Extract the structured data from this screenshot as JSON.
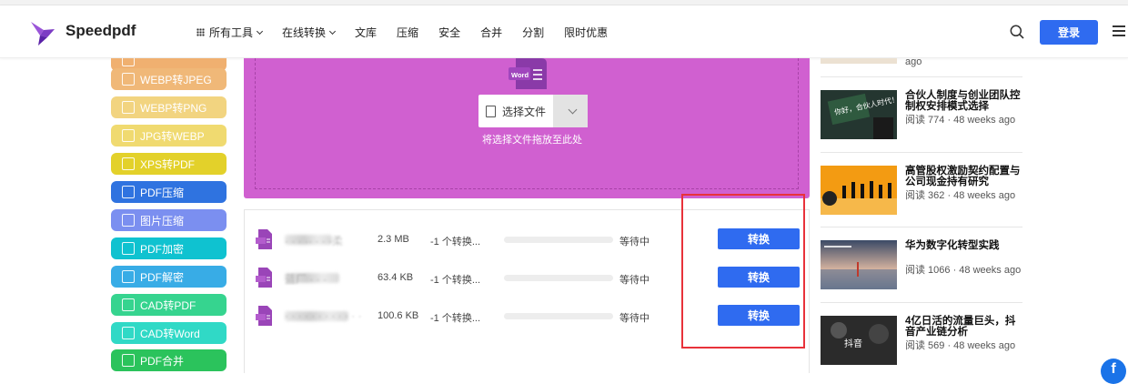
{
  "header": {
    "brand": "Speedpdf",
    "nav": [
      {
        "label": "所有工具",
        "has_grid": true,
        "has_chevron": true
      },
      {
        "label": "在线转换",
        "has_grid": false,
        "has_chevron": true
      },
      {
        "label": "文库",
        "has_grid": false,
        "has_chevron": false
      },
      {
        "label": "压缩",
        "has_grid": false,
        "has_chevron": false
      },
      {
        "label": "安全",
        "has_grid": false,
        "has_chevron": false
      },
      {
        "label": "合并",
        "has_grid": false,
        "has_chevron": false
      },
      {
        "label": "分割",
        "has_grid": false,
        "has_chevron": false
      },
      {
        "label": "限时优惠",
        "has_grid": false,
        "has_chevron": false
      }
    ],
    "login_label": "登录",
    "icons": [
      "search-icon",
      "menu-icon"
    ]
  },
  "sidebar": {
    "tools": [
      {
        "label": "",
        "color": "#f0b070"
      },
      {
        "label": "WEBP转JPEG",
        "color": "#f0b878"
      },
      {
        "label": "WEBP转PNG",
        "color": "#f2d480"
      },
      {
        "label": "JPG转WEBP",
        "color": "#f0da70"
      },
      {
        "label": "XPS转PDF",
        "color": "#e3d12a"
      },
      {
        "label": "PDF压缩",
        "color": "#2f73e0"
      },
      {
        "label": "图片压缩",
        "color": "#7b8ff0"
      },
      {
        "label": "PDF加密",
        "color": "#0fc2d0"
      },
      {
        "label": "PDF解密",
        "color": "#38ace6"
      },
      {
        "label": "CAD转PDF",
        "color": "#36d48f"
      },
      {
        "label": "CAD转Word",
        "color": "#30d9c6"
      },
      {
        "label": "PDF合并",
        "color": "#2bc35c"
      }
    ]
  },
  "upload": {
    "icon_label": "Word",
    "select_label": "选择文件",
    "drop_hint": "将选择文件拖放至此处",
    "bg_color": "#d060d0"
  },
  "files": [
    {
      "name": "·  ·  ·  ··  ·  ·  ·柔",
      "size": "2.3 MB",
      "conversion": "-1 个转换...",
      "progress": 0,
      "status": "等待中",
      "button": "转换"
    },
    {
      "name": "蓝厂  ·  ·  ·",
      "size": "63.4 KB",
      "conversion": "-1 个转换...",
      "progress": 0,
      "status": "等待中",
      "button": "转换"
    },
    {
      "name": "·  ·  ·  ·  ·  ·  ·  ·  ·  ·  ·  ·",
      "size": "100.6 KB",
      "conversion": "-1 个转换...",
      "progress": 0,
      "status": "等待中",
      "button": "转换"
    }
  ],
  "articles_top": {
    "ago": "ago"
  },
  "articles": [
    {
      "title": "合伙人制度与创业团队控制权安排模式选择",
      "meta": "阅读 774 · 48 weeks ago",
      "thumb_text": "你好，合伙人时代！",
      "thumb_color": "#2a3c33"
    },
    {
      "title": "高管股权激励契约配置与公司现金持有研究",
      "meta": "阅读 362 · 48 weeks ago",
      "thumb_text": "",
      "thumb_color": "#f29a10"
    },
    {
      "title": "华为数字化转型实践",
      "meta": "阅读 1066 · 48 weeks ago",
      "thumb_text": "",
      "thumb_color": "#bcc6d6"
    },
    {
      "title": "4亿日活的流量巨头，抖音产业链分析",
      "meta": "阅读 569 · 48 weeks ago",
      "thumb_text": "抖音",
      "thumb_color": "#2d2d2d"
    }
  ]
}
